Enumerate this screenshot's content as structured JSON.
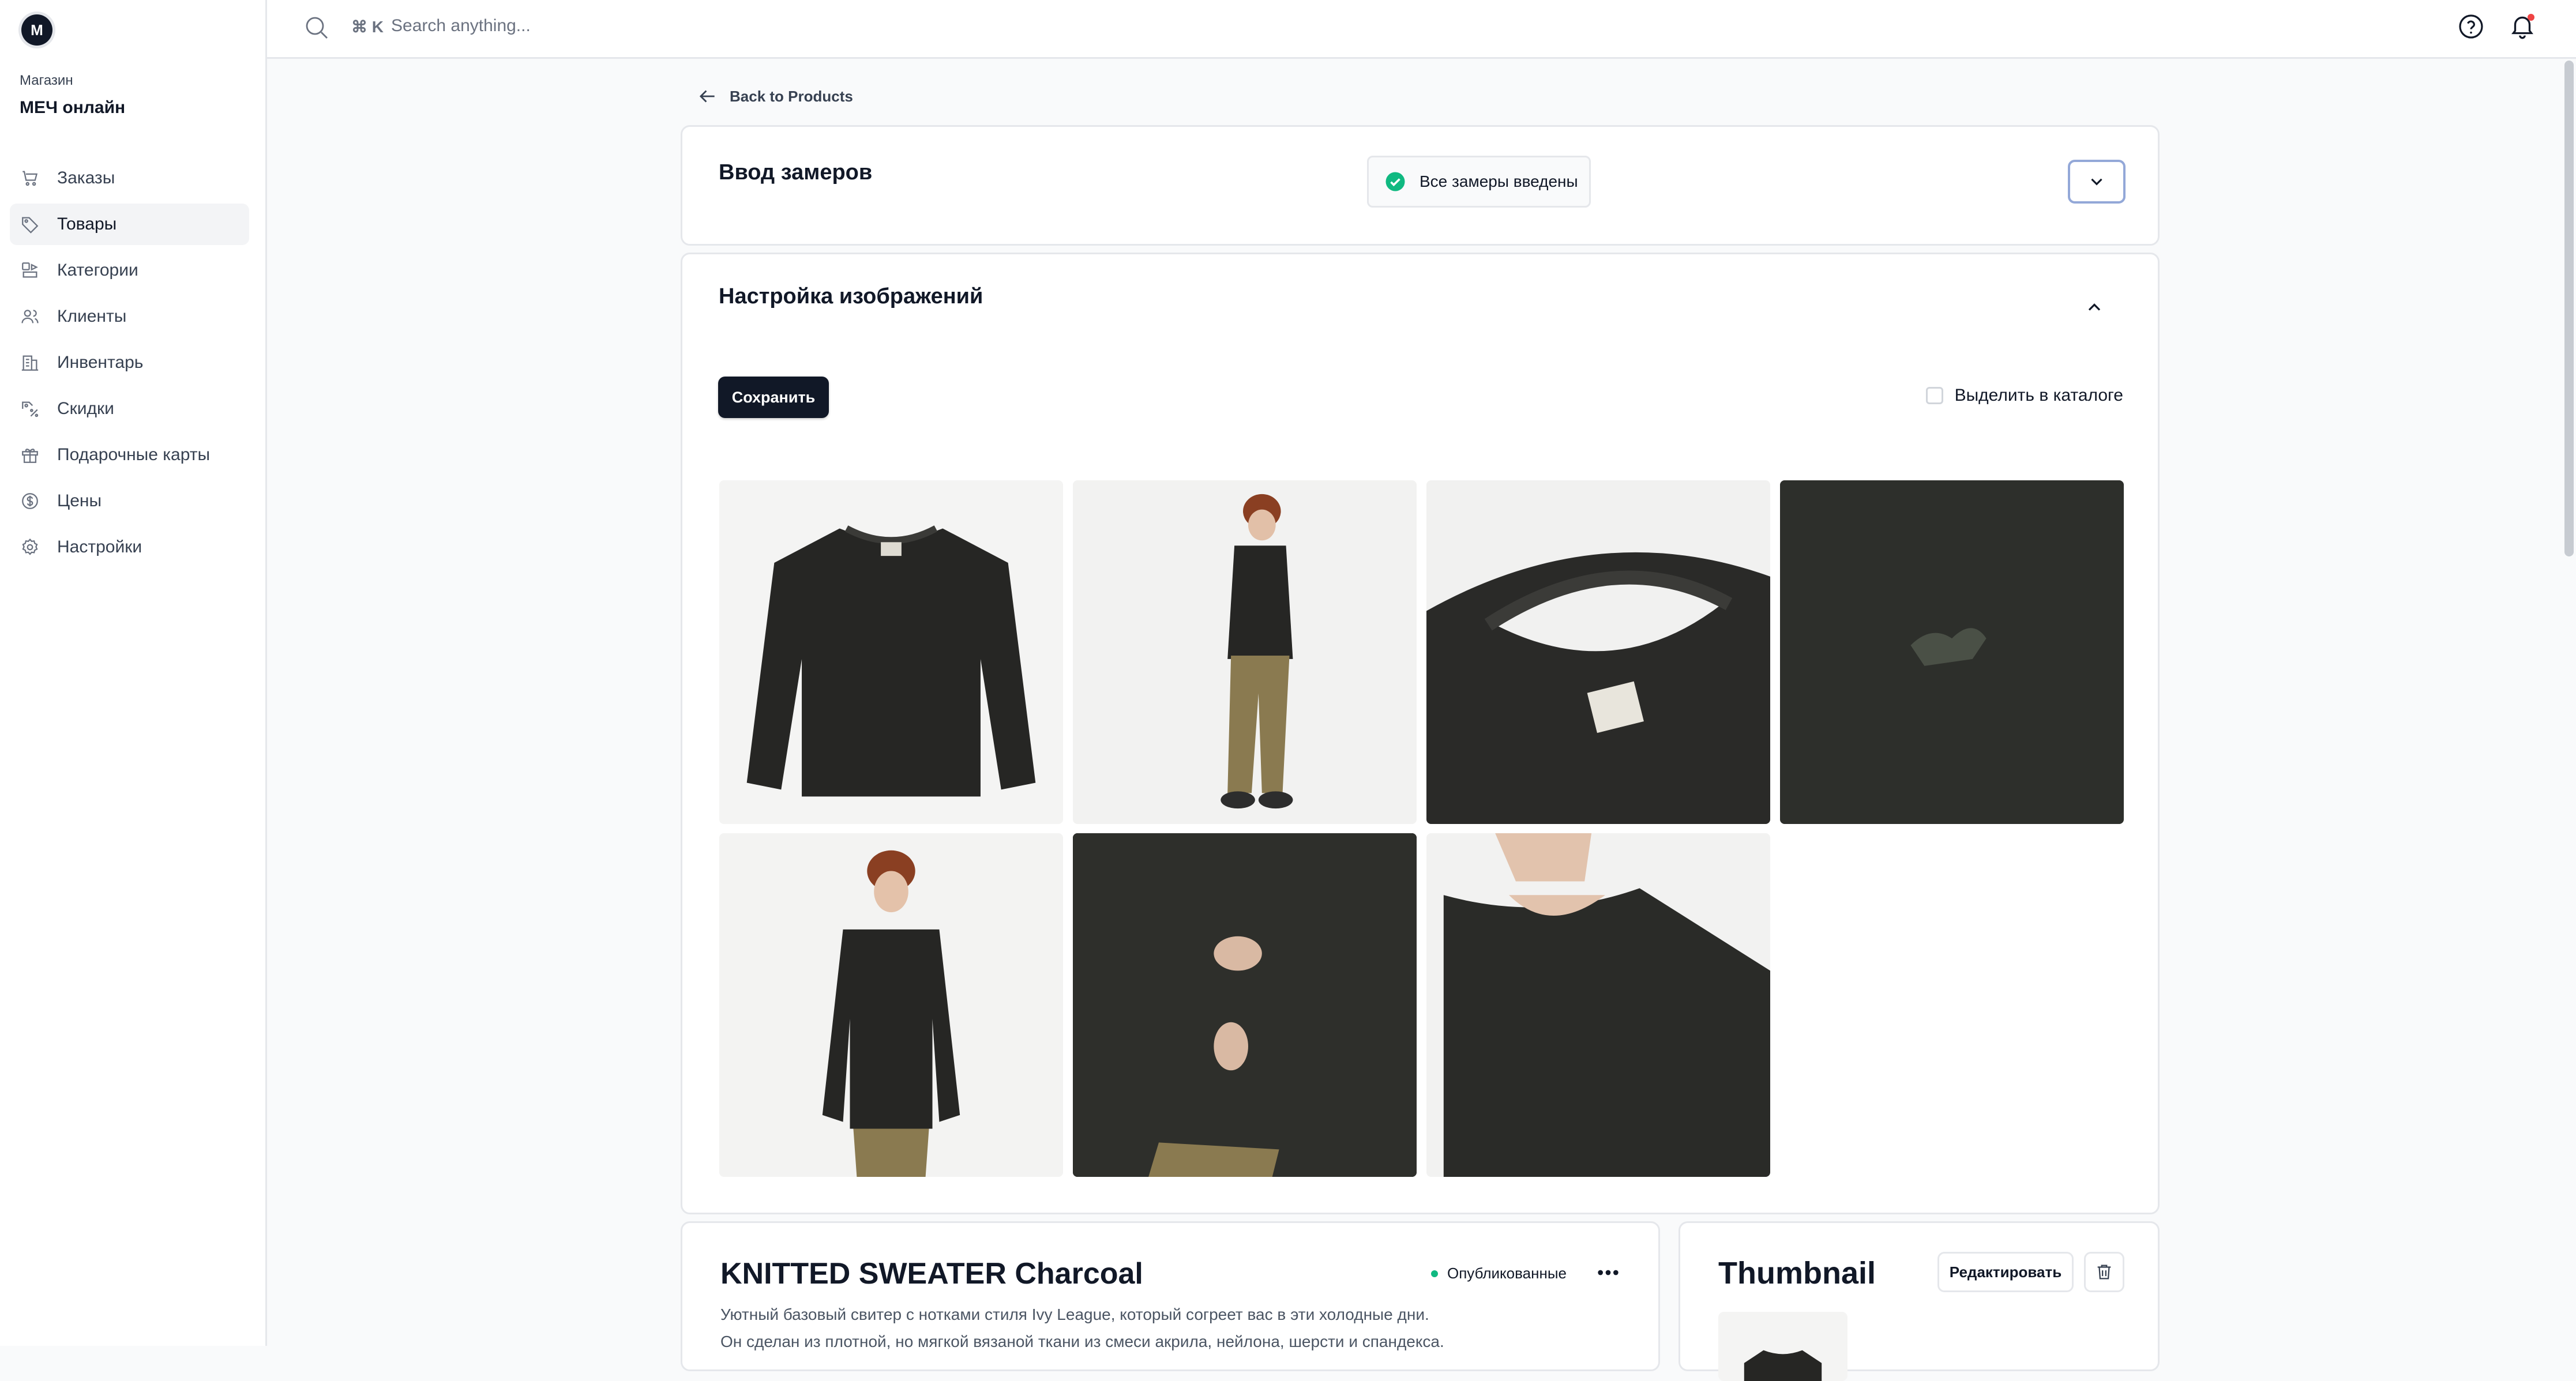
{
  "sidebar": {
    "avatar_letter": "M",
    "store_caption": "Магазин",
    "store_name": "МЕЧ онлайн",
    "items": [
      {
        "label": "Заказы",
        "icon": "cart-icon"
      },
      {
        "label": "Товары",
        "icon": "tag-icon",
        "active": true
      },
      {
        "label": "Категории",
        "icon": "categories-icon"
      },
      {
        "label": "Клиенты",
        "icon": "users-icon"
      },
      {
        "label": "Инвентарь",
        "icon": "building-icon"
      },
      {
        "label": "Скидки",
        "icon": "discount-icon"
      },
      {
        "label": "Подарочные карты",
        "icon": "gift-icon"
      },
      {
        "label": "Цены",
        "icon": "dollar-icon"
      },
      {
        "label": "Настройки",
        "icon": "gear-icon"
      }
    ]
  },
  "topbar": {
    "shortcut": "⌘ K",
    "search_placeholder": "Search anything..."
  },
  "page": {
    "back_label": "Back to Products"
  },
  "measurements": {
    "title": "Ввод замеров",
    "status": "Все замеры введены"
  },
  "images_section": {
    "title": "Настройка изображений",
    "save_label": "Сохранить",
    "feature_label": "Выделить в каталоге",
    "images": [
      {
        "icon": "sweater-flat-image"
      },
      {
        "icon": "model-side-image"
      },
      {
        "icon": "collar-label-image"
      },
      {
        "icon": "knit-texture-image"
      },
      {
        "icon": "model-front-image"
      },
      {
        "icon": "sleeve-detail-image"
      },
      {
        "icon": "model-crop-image"
      }
    ]
  },
  "product": {
    "title": "KNITTED SWEATER Charcoal",
    "status": "Опубликованные",
    "description_1": "Уютный базовый свитер с нотками стиля Ivy League, который согреет вас в эти холодные дни.",
    "description_2": "Он сделан из плотной, но мягкой вязаной ткани из смеси акрила, нейлона, шерсти и спандекса."
  },
  "thumbnail": {
    "title": "Thumbnail",
    "edit_label": "Редактировать"
  },
  "colors": {
    "accent_dark": "#111827",
    "success": "#10b981",
    "focus_ring": "#93a8d8"
  }
}
